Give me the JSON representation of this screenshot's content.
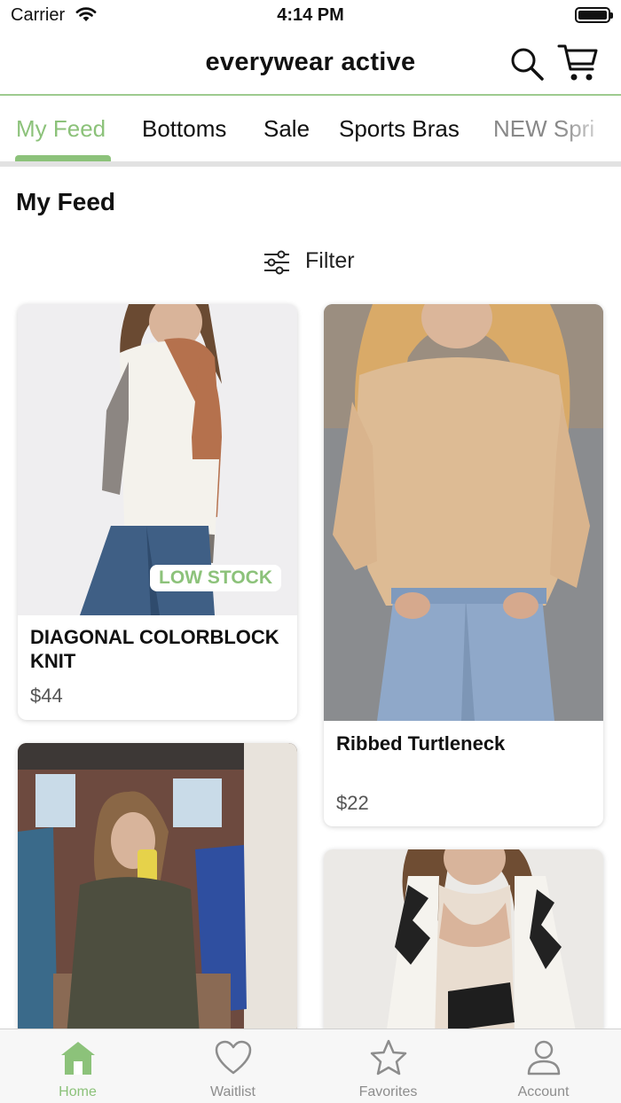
{
  "status_bar": {
    "carrier": "Carrier",
    "time": "4:14 PM"
  },
  "header": {
    "title": "everywear active",
    "search_icon": "search-icon",
    "cart_icon": "cart-icon"
  },
  "tabs": [
    {
      "label": "My Feed",
      "active": true
    },
    {
      "label": "Bottoms"
    },
    {
      "label": "Sale"
    },
    {
      "label": "Sports Bras"
    },
    {
      "label": "NEW Spri"
    }
  ],
  "feed": {
    "title": "My Feed",
    "filter_label": "Filter",
    "products": [
      {
        "name": "DIAGONAL COLORBLOCK KNIT",
        "price": "$44",
        "badge": "LOW STOCK"
      },
      {
        "name": "Ribbed Turtleneck",
        "price": "$22"
      },
      {
        "name": "",
        "price": ""
      },
      {
        "name": "",
        "price": ""
      }
    ]
  },
  "tab_bar": [
    {
      "label": "Home",
      "icon": "home-icon",
      "active": true
    },
    {
      "label": "Waitlist",
      "icon": "heart-icon"
    },
    {
      "label": "Favorites",
      "icon": "star-icon"
    },
    {
      "label": "Account",
      "icon": "person-icon"
    }
  ],
  "colors": {
    "accent": "#8cc27a",
    "header_rule": "#9ecb8f",
    "text": "#111111",
    "muted": "#8d8d8d"
  }
}
